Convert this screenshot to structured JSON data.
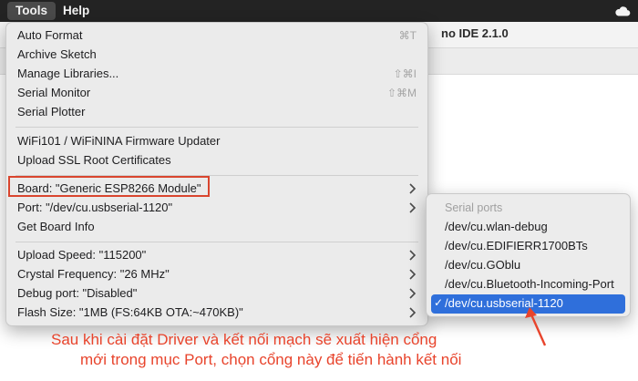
{
  "menubar": {
    "items": [
      {
        "label": "Tools",
        "active": true
      },
      {
        "label": "Help",
        "active": false
      }
    ],
    "cloud_icon": "cloud-icon"
  },
  "window": {
    "title": "no IDE 2.1.0"
  },
  "tools_menu": {
    "items": [
      {
        "label": "Auto Format",
        "shortcut": "⌘T"
      },
      {
        "label": "Archive Sketch",
        "shortcut": ""
      },
      {
        "label": "Manage Libraries...",
        "shortcut": "⇧⌘I"
      },
      {
        "label": "Serial Monitor",
        "shortcut": "⇧⌘M"
      },
      {
        "label": "Serial Plotter",
        "shortcut": ""
      },
      {
        "label": "WiFi101 / WiFiNINA Firmware Updater",
        "shortcut": ""
      },
      {
        "label": "Upload SSL Root Certificates",
        "shortcut": ""
      },
      {
        "label": "Board: \"Generic ESP8266 Module\"",
        "submenu": true
      },
      {
        "label": "Port: \"/dev/cu.usbserial-1120\"",
        "submenu": true
      },
      {
        "label": "Get Board Info",
        "shortcut": ""
      },
      {
        "label": "Upload Speed: \"115200\"",
        "submenu": true
      },
      {
        "label": "Crystal Frequency: \"26 MHz\"",
        "submenu": true
      },
      {
        "label": "Debug port: \"Disabled\"",
        "submenu": true
      },
      {
        "label": "Flash Size: \"1MB (FS:64KB OTA:~470KB)\"",
        "submenu": true
      }
    ]
  },
  "port_submenu": {
    "header": "Serial ports",
    "items": [
      {
        "label": "/dev/cu.wlan-debug",
        "selected": false
      },
      {
        "label": "/dev/cu.EDIFIERR1700BTs",
        "selected": false
      },
      {
        "label": "/dev/cu.GOblu",
        "selected": false
      },
      {
        "label": "/dev/cu.Bluetooth-Incoming-Port",
        "selected": false
      },
      {
        "label": "/dev/cu.usbserial-1120",
        "selected": true
      }
    ],
    "check_mark": "✓"
  },
  "annotation": {
    "line1": "Sau khi cài đặt Driver và kết nối mạch sẽ xuất hiện cổng",
    "line2": "mới trong mục Port, chọn cổng này để tiến hành kết nối",
    "color": "#e8442c"
  },
  "colors": {
    "highlight_box": "#d9452e",
    "selection": "#2f6fdb",
    "menubar": "#232323"
  }
}
